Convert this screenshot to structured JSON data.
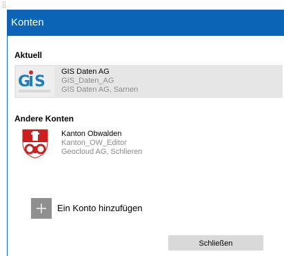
{
  "header": {
    "title": "Konten"
  },
  "current": {
    "label": "Aktuell",
    "account": {
      "name": "GIS Daten AG",
      "user": "GIS_Daten_AG",
      "org": "GIS Daten AG, Sarnen"
    }
  },
  "others": {
    "label": "Andere Konten",
    "accounts": [
      {
        "name": "Kanton Obwalden",
        "user": "Kanton_OW_Editor",
        "org": "Geocloud AG, Schlieren"
      }
    ]
  },
  "add_account": {
    "label": "Ein Konto hinzufügen"
  },
  "close_button": {
    "label": "Schließen"
  },
  "colors": {
    "header_bg": "#0b64b5",
    "selected_bg": "#e6e6e6",
    "button_bg": "#d9d9d9"
  },
  "icons": {
    "add": "plus-icon",
    "gis_logo": "gis-logo-icon",
    "ow_logo": "obwalden-crest-icon"
  }
}
